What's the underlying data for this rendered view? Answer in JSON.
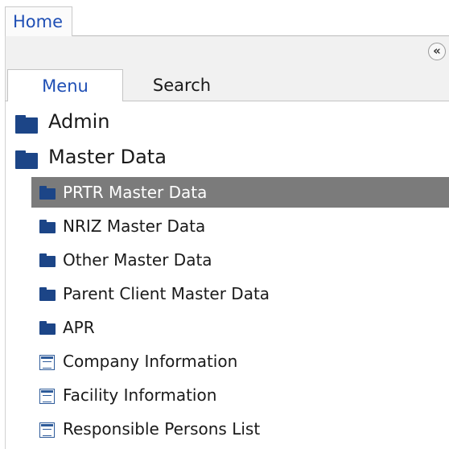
{
  "header": {
    "home_tab": "Home",
    "collapse_glyph": "«"
  },
  "tabs": {
    "menu": "Menu",
    "search": "Search",
    "active": "Menu"
  },
  "tree": {
    "admin": {
      "label": "Admin",
      "icon": "folder-icon"
    },
    "master_data": {
      "label": "Master Data",
      "icon": "folder-icon",
      "children": [
        {
          "label": "PRTR Master Data",
          "icon": "folder-icon",
          "selected": true
        },
        {
          "label": "NRIZ Master Data",
          "icon": "folder-icon"
        },
        {
          "label": "Other Master Data",
          "icon": "folder-icon"
        },
        {
          "label": "Parent Client Master Data",
          "icon": "folder-icon"
        },
        {
          "label": "APR",
          "icon": "folder-icon"
        },
        {
          "label": "Company Information",
          "icon": "form-icon"
        },
        {
          "label": "Facility Information",
          "icon": "form-icon"
        },
        {
          "label": "Responsible Persons List",
          "icon": "form-icon"
        }
      ]
    }
  },
  "colors": {
    "accent_text": "#1f4fb5",
    "folder": "#1c4587",
    "selected_row": "#7b7b7b",
    "panel_bg": "#f1f1f1"
  }
}
